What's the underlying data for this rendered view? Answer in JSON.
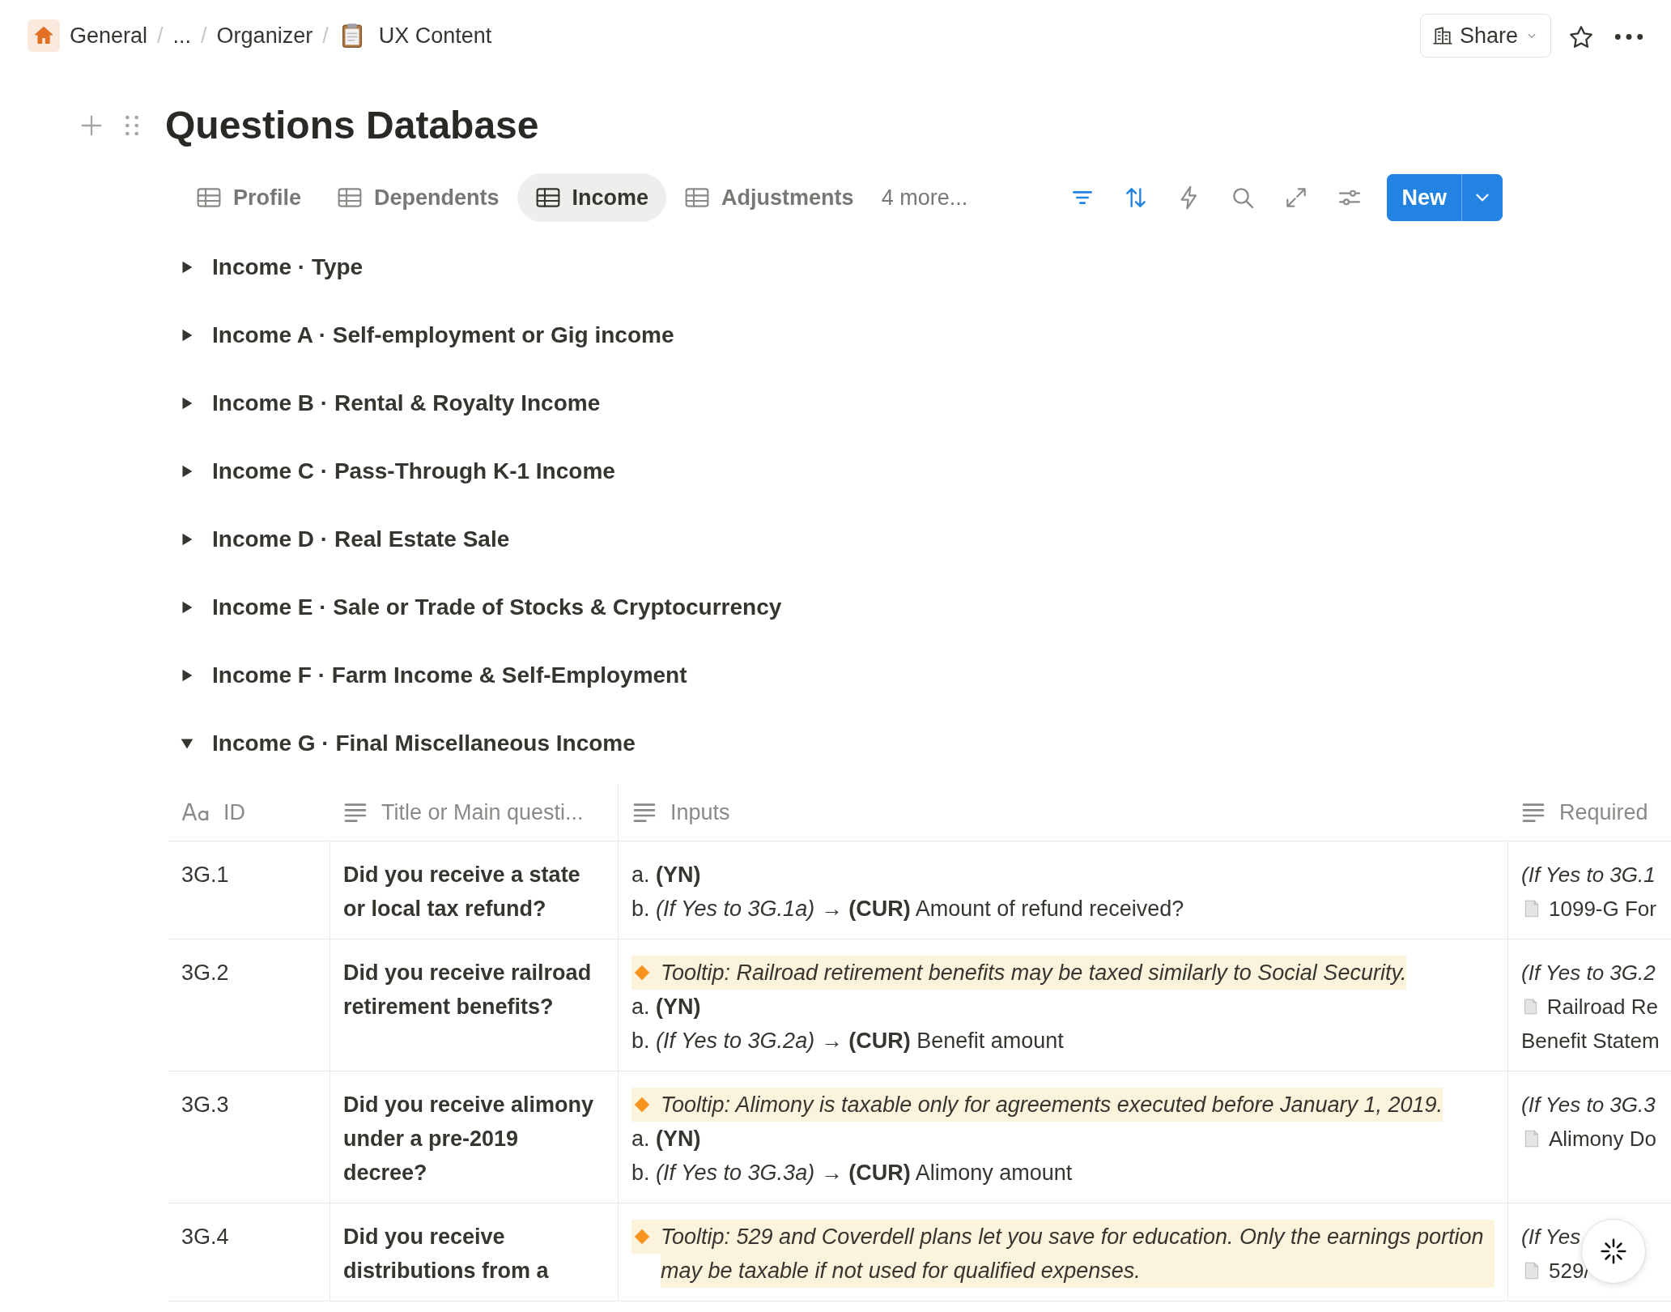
{
  "breadcrumb": [
    {
      "kind": "home",
      "text": "General"
    },
    {
      "kind": "separator",
      "text": "/"
    },
    {
      "kind": "link",
      "text": "..."
    },
    {
      "kind": "separator",
      "text": "/"
    },
    {
      "kind": "link",
      "text": "Organizer"
    },
    {
      "kind": "separator",
      "text": "/"
    },
    {
      "kind": "clipboard",
      "text": "UX Content"
    }
  ],
  "share": "Share",
  "title": "Questions Database",
  "tabs": [
    {
      "label": "Profile",
      "selected": false
    },
    {
      "label": "Dependents",
      "selected": false
    },
    {
      "label": "Income",
      "selected": true
    },
    {
      "label": "Adjustments",
      "selected": false
    }
  ],
  "more_tabs": "4 more...",
  "toolbar": [
    {
      "kind": "filter",
      "active": true
    },
    {
      "kind": "sort",
      "active": true
    },
    {
      "kind": "bolt",
      "active": false
    },
    {
      "kind": "search",
      "active": false
    },
    {
      "kind": "expand",
      "active": false
    },
    {
      "kind": "settings",
      "active": false
    }
  ],
  "new_button": "New",
  "groups": [
    {
      "title": "Income · Type",
      "expanded": false
    },
    {
      "title": "Income A · Self-employment or Gig income",
      "expanded": false
    },
    {
      "title": "Income B · Rental & Royalty Income",
      "expanded": false
    },
    {
      "title": "Income C · Pass-Through K-1 Income",
      "expanded": false
    },
    {
      "title": "Income D · Real Estate Sale",
      "expanded": false
    },
    {
      "title": "Income E · Sale or Trade of Stocks & Cryptocurrency",
      "expanded": false
    },
    {
      "title": "Income F · Farm Income & Self-Employment",
      "expanded": false
    },
    {
      "title": "Income G · Final Miscellaneous Income",
      "expanded": true
    }
  ],
  "table": {
    "columns": [
      {
        "label": "ID",
        "kind": "title"
      },
      {
        "label": "Title or Main questi...",
        "kind": "text"
      },
      {
        "label": "Inputs",
        "kind": "text"
      },
      {
        "label": "Required",
        "kind": "text"
      }
    ],
    "rows": [
      {
        "id": "3G.1",
        "title": "Did you receive a state or local tax refund?",
        "inputs": [
          {
            "kind": "line",
            "text": "a. **(YN)**"
          },
          {
            "kind": "line",
            "text": "b. *(If Yes to 3G.1a)* → **(CUR)** Amount of refund received?"
          }
        ],
        "required": [
          {
            "kind": "condition",
            "text": "(If Yes to 3G.1"
          },
          {
            "kind": "file",
            "text": "1099-G For"
          }
        ]
      },
      {
        "id": "3G.2",
        "title": "Did you receive railroad retirement benefits?",
        "inputs": [
          {
            "kind": "tooltip",
            "text": "Tooltip: Railroad retirement benefits may be taxed similarly to Social Security."
          },
          {
            "kind": "line",
            "text": "a. **(YN)**"
          },
          {
            "kind": "line",
            "text": "b. *(If Yes to 3G.2a)* → **(CUR)** Benefit amount"
          }
        ],
        "required": [
          {
            "kind": "condition",
            "text": "(If Yes to 3G.2"
          },
          {
            "kind": "file",
            "text": "Railroad Re"
          },
          {
            "kind": "plain",
            "text": "Benefit Statem"
          }
        ]
      },
      {
        "id": "3G.3",
        "title": "Did you receive alimony under a pre-2019 decree?",
        "inputs": [
          {
            "kind": "tooltip",
            "text": "Tooltip: Alimony is taxable only for agreements executed before January 1, 2019."
          },
          {
            "kind": "line",
            "text": "a. **(YN)**"
          },
          {
            "kind": "line",
            "text": "b. *(If Yes to 3G.3a)* → **(CUR)** Alimony amount"
          }
        ],
        "required": [
          {
            "kind": "condition",
            "text": "(If Yes to 3G.3"
          },
          {
            "kind": "file",
            "text": "Alimony Do"
          }
        ]
      },
      {
        "id": "3G.4",
        "title": "Did you receive distributions from a",
        "inputs": [
          {
            "kind": "tooltip",
            "text": "Tooltip: 529 and Coverdell plans let you save for education. Only the earnings portion may be taxable if not used for qualified expenses."
          }
        ],
        "required": [
          {
            "kind": "condition",
            "text": "(If Yes"
          },
          {
            "kind": "file",
            "text": "529/"
          }
        ]
      }
    ]
  }
}
